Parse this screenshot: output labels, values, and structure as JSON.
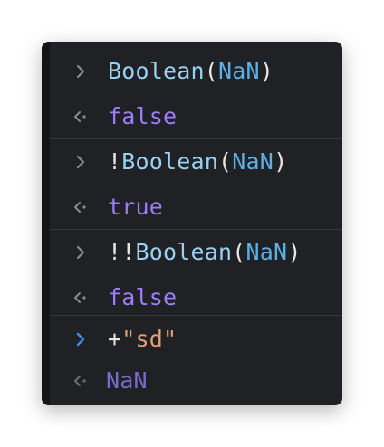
{
  "colors": {
    "panel_bg": "#202124",
    "function": "#99d1f5",
    "nan_arg": "#5db0e6",
    "punctuation": "#e6e6e6",
    "string": "#e69f7a",
    "boolean": "#9d7dfa",
    "nan_result": "#7a6acb",
    "active_prompt": "#3f8cf0"
  },
  "icons": {
    "input_prompt": "chevron-right-icon",
    "result_prompt": "return-arrow-icon"
  },
  "entries": [
    {
      "input": {
        "prefix": "",
        "fn": "Boolean",
        "open": "(",
        "arg": "NaN",
        "close": ")"
      },
      "output": "false"
    },
    {
      "input": {
        "prefix": "!",
        "fn": "Boolean",
        "open": "(",
        "arg": "NaN",
        "close": ")"
      },
      "output": "true"
    },
    {
      "input": {
        "prefix": "!!",
        "fn": "Boolean",
        "open": "(",
        "arg": "NaN",
        "close": ")"
      },
      "output": "false"
    },
    {
      "input": {
        "prefix": "+",
        "string": "\"sd\""
      },
      "output": "NaN"
    }
  ]
}
